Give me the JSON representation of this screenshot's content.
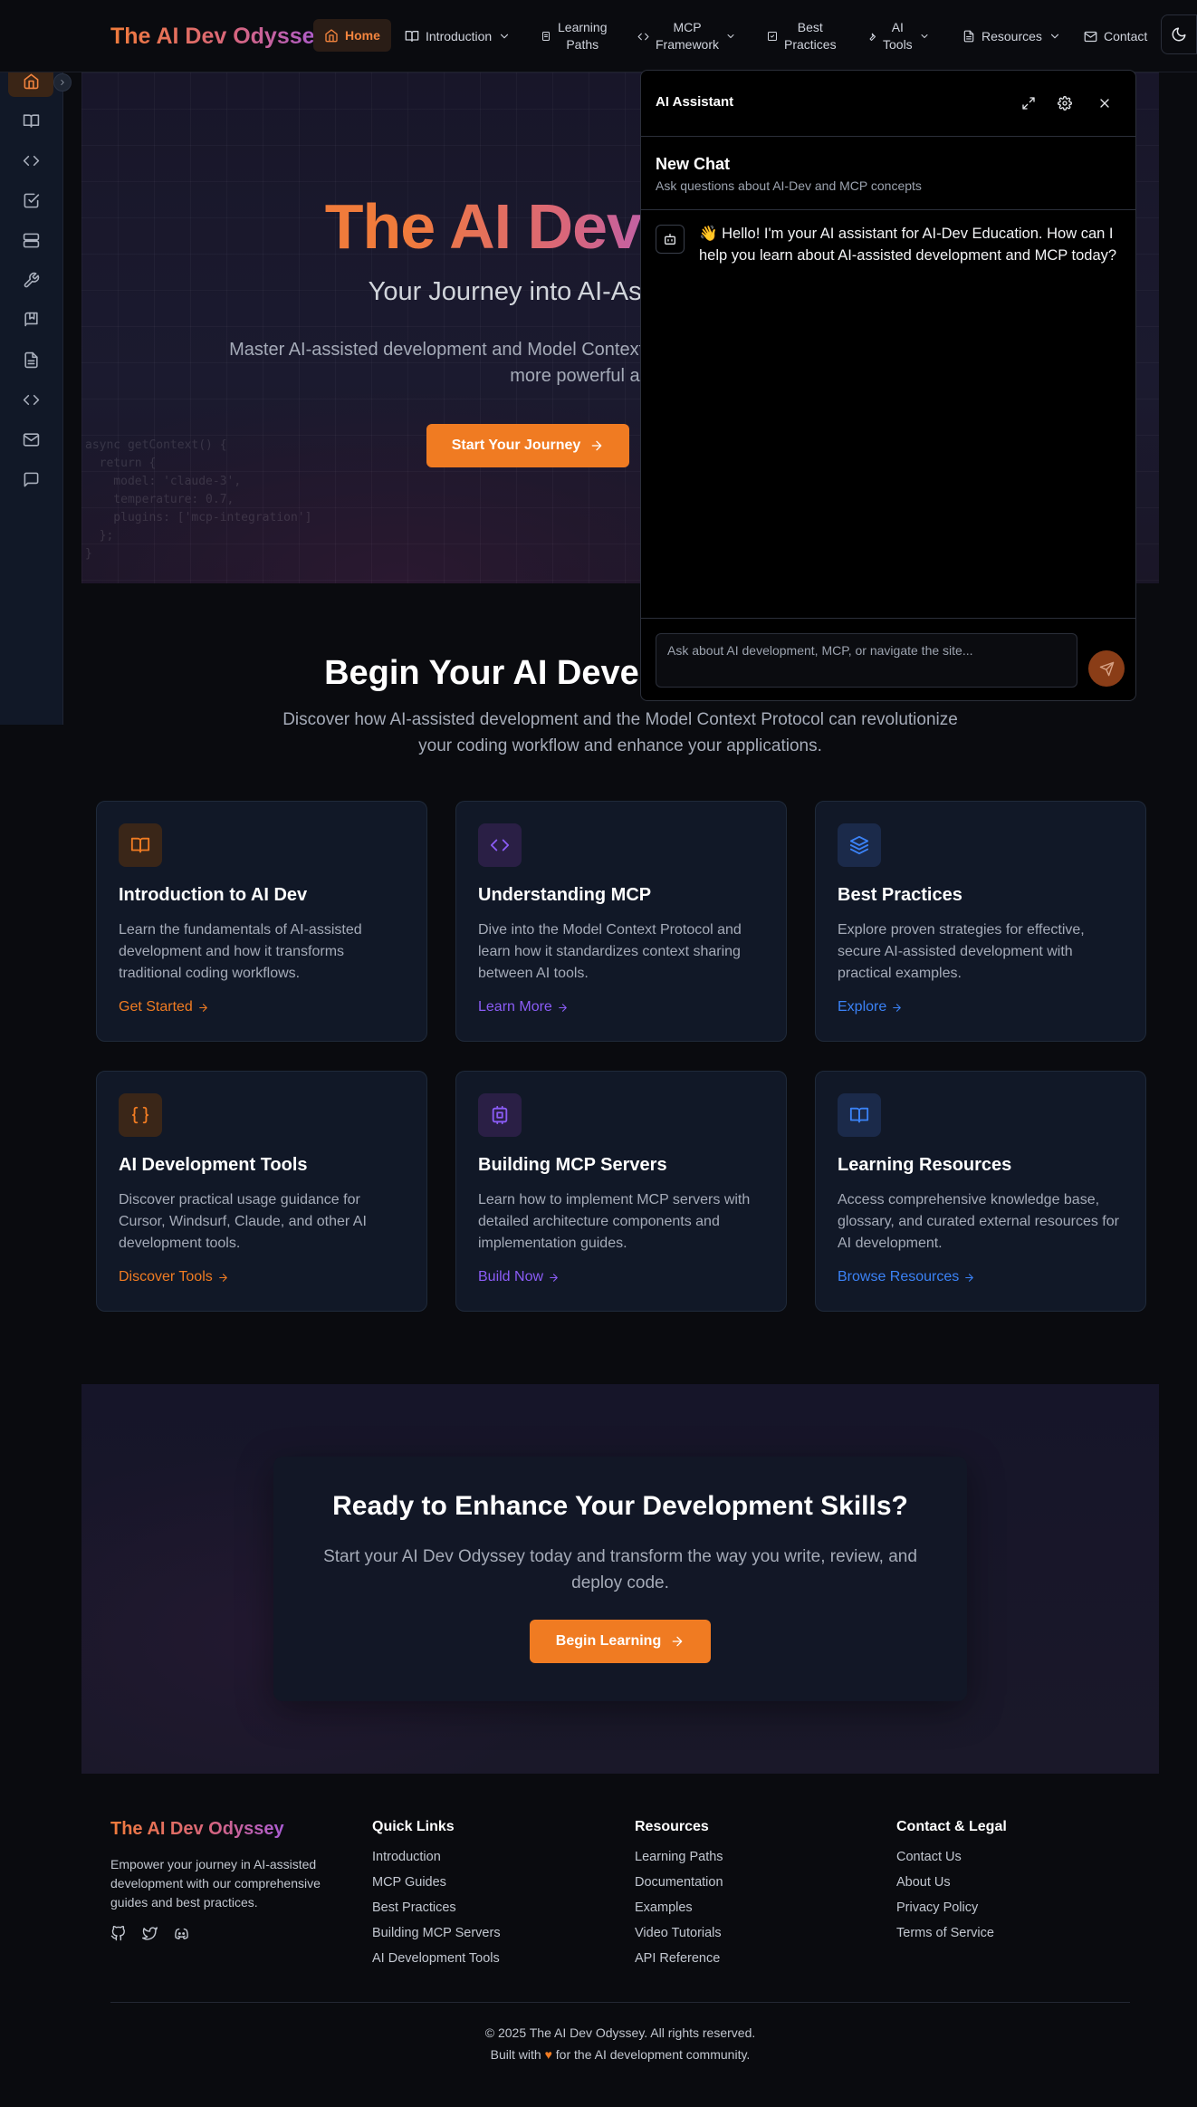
{
  "brand": "The AI Dev Odyssey",
  "nav": {
    "home": "Home",
    "introduction": "Introduction",
    "learning_paths": [
      "Learning",
      "Paths"
    ],
    "mcp_framework": [
      "MCP",
      "Framework"
    ],
    "best_practices": [
      "Best",
      "Practices"
    ],
    "ai_tools": [
      "AI",
      "Tools"
    ],
    "resources": "Resources",
    "contact": "Contact"
  },
  "sidebar_icons": [
    "home-icon",
    "book-icon",
    "code-icon",
    "check-square-icon",
    "server-icon",
    "wrench-icon",
    "bookmark-icon",
    "file-text-icon",
    "code-icon",
    "mail-icon",
    "message-icon"
  ],
  "hero": {
    "title": "The AI Dev Odyssey",
    "subtitle": "Your Journey into AI-Assisted Development",
    "description": "Master AI-assisted development and Model Context Protocol to transform your workflow and build more powerful applications.",
    "cta": "Start Your Journey",
    "code_lines": [
      "async getContext() {",
      "  return {",
      "    model: 'claude-3',",
      "    temperature: 0.7,",
      "    plugins: ['mcp-integration']",
      "  };",
      "}"
    ]
  },
  "chat": {
    "title": "AI Assistant",
    "new_chat": "New Chat",
    "hint": "Ask questions about AI-Dev and MCP concepts",
    "greeting": "👋 Hello! I'm your AI assistant for AI-Dev Education. How can I help you learn about AI-assisted development and MCP today?",
    "input_placeholder": "Ask about AI development, MCP, or navigate the site..."
  },
  "features": {
    "title": "Begin Your AI Development Journey",
    "description": "Discover how AI-assisted development and the Model Context Protocol can revolutionize your coding workflow and enhance your applications.",
    "cards": [
      {
        "title": "Introduction to AI Dev",
        "desc": "Learn the fundamentals of AI-assisted development and how it transforms traditional coding workflows.",
        "link": "Get Started",
        "accent": "#f07b22",
        "icon": "book-open-icon"
      },
      {
        "title": "Understanding MCP",
        "desc": "Dive into the Model Context Protocol and learn how it standardizes context sharing between AI tools.",
        "link": "Learn More",
        "accent": "#8b5cf6",
        "icon": "code-icon"
      },
      {
        "title": "Best Practices",
        "desc": "Explore proven strategies for effective, secure AI-assisted development with practical examples.",
        "link": "Explore",
        "accent": "#3b82f6",
        "icon": "layers-icon"
      },
      {
        "title": "AI Development Tools",
        "desc": "Discover practical usage guidance for Cursor, Windsurf, Claude, and other AI development tools.",
        "link": "Discover Tools",
        "accent": "#f07b22",
        "icon": "braces-icon"
      },
      {
        "title": "Building MCP Servers",
        "desc": "Learn how to implement MCP servers with detailed architecture components and implementation guides.",
        "link": "Build Now",
        "accent": "#8b5cf6",
        "icon": "server-icon"
      },
      {
        "title": "Learning Resources",
        "desc": "Access comprehensive knowledge base, glossary, and curated external resources for AI development.",
        "link": "Browse Resources",
        "accent": "#3b82f6",
        "icon": "book-open-icon"
      }
    ]
  },
  "cta": {
    "title": "Ready to Enhance Your Development Skills?",
    "description": "Start your AI Dev Odyssey today and transform the way you write, review, and deploy code.",
    "button": "Begin Learning"
  },
  "footer": {
    "brand": "The AI Dev Odyssey",
    "tagline": "Empower your journey in AI-assisted development with our comprehensive guides and best practices.",
    "quick_links": {
      "title": "Quick Links",
      "items": [
        "Introduction",
        "MCP Guides",
        "Best Practices",
        "Building MCP Servers",
        "AI Development Tools"
      ]
    },
    "resources": {
      "title": "Resources",
      "items": [
        "Learning Paths",
        "Documentation",
        "Examples",
        "Video Tutorials",
        "API Reference"
      ]
    },
    "legal": {
      "title": "Contact & Legal",
      "items": [
        "Contact Us",
        "About Us",
        "Privacy Policy",
        "Terms of Service"
      ]
    },
    "copyright": "© 2025 The AI Dev Odyssey. All rights reserved.",
    "built_prefix": "Built with",
    "built_heart": "♥",
    "built_suffix": "for the AI development community."
  },
  "colors": {
    "accent_orange": "#f07b22",
    "accent_purple": "#8b5cf6",
    "accent_blue": "#3b82f6",
    "background": "#0a0b0f"
  }
}
